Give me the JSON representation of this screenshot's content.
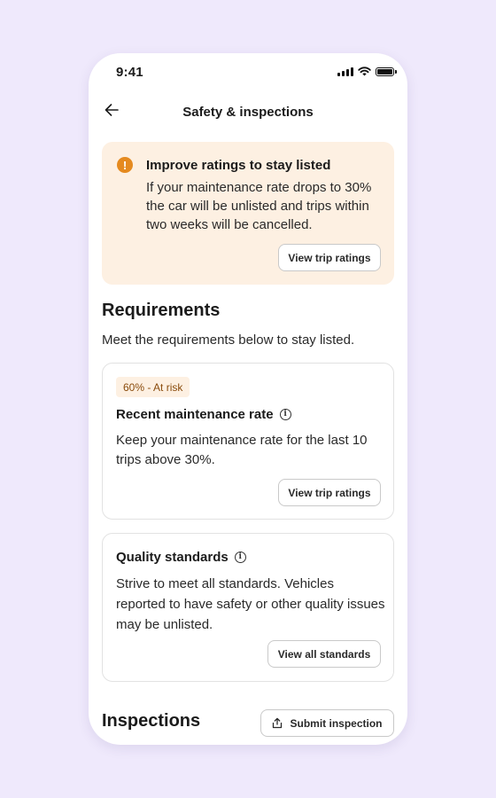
{
  "status_bar": {
    "time": "9:41"
  },
  "header": {
    "title": "Safety & inspections"
  },
  "alert": {
    "title": "Improve ratings to stay listed",
    "body": "If your maintenance rate drops to 30% the car will be unlisted and trips within two weeks will be cancelled.",
    "button_label": "View trip ratings",
    "accent_color": "#e58a1f",
    "background_color": "#fdf0e2"
  },
  "requirements": {
    "heading": "Requirements",
    "subtitle": "Meet the requirements below to stay listed.",
    "cards": [
      {
        "badge": "60% - At risk",
        "title": "Recent maintenance rate",
        "body": "Keep your maintenance rate for the last 10 trips above 30%.",
        "button_label": "View trip ratings"
      },
      {
        "title": "Quality standards",
        "body": "Strive to meet all standards. Vehicles reported to have safety or other quality issues may be unlisted.",
        "button_label": "View all standards"
      }
    ]
  },
  "inspections": {
    "heading": "Inspections",
    "button_label": "Submit inspection"
  },
  "icons": {
    "back": "arrow-left-icon",
    "alert": "warning-icon",
    "info": "info-icon",
    "submit": "upload-icon"
  },
  "colors": {
    "page_background": "#efe9fc",
    "badge_text": "#8a4b0c"
  }
}
